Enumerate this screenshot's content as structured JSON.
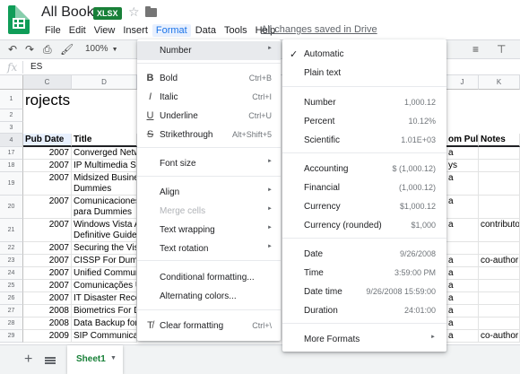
{
  "app": {
    "doc_title": "All Books",
    "file_badge": "XLSX",
    "saved_status": "All changes saved in Drive",
    "colors": {
      "brand_green": "#0f9d58",
      "accent_blue": "#1a73e8"
    }
  },
  "menubar": {
    "items": [
      {
        "label": "File"
      },
      {
        "label": "Edit"
      },
      {
        "label": "View"
      },
      {
        "label": "Insert"
      },
      {
        "label": "Format",
        "active": true
      },
      {
        "label": "Data"
      },
      {
        "label": "Tools"
      },
      {
        "label": "Help"
      }
    ]
  },
  "toolbar": {
    "zoom": "100%",
    "icons": [
      "undo-icon",
      "redo-icon",
      "print-icon",
      "paint-format-icon",
      "align-icon",
      "valign-icon"
    ]
  },
  "formula_bar": {
    "fx": "fx",
    "value": "ES"
  },
  "grid": {
    "columns": [
      {
        "label": "C",
        "selected": true
      },
      {
        "label": "D"
      },
      {
        "label": "J"
      },
      {
        "label": "K"
      }
    ],
    "title_cell": "rojects",
    "header_row": {
      "row": "4",
      "pub_date": "Pub Date",
      "title": "Title",
      "com_pub": "om Pul",
      "notes": "Notes"
    },
    "rows": [
      {
        "row": "1"
      },
      {
        "row": "2"
      },
      {
        "row": "3"
      },
      {
        "row": "17",
        "year": "2007",
        "title": "Converged Netw",
        "j": "a",
        "k": ""
      },
      {
        "row": "18",
        "year": "2007",
        "title": "IP Multimedia Su",
        "j": "ys",
        "k": ""
      },
      {
        "row": "19",
        "year": "2007",
        "title": "Midsized Busine\nDummies",
        "j": "a",
        "k": ""
      },
      {
        "row": "20",
        "year": "2007",
        "title": "Comunicaciones\npara Dummies",
        "j": "a",
        "k": ""
      },
      {
        "row": "21",
        "year": "2007",
        "title": "Windows Vista A\nDefinitive Guide",
        "j": "a",
        "k": "contributo"
      },
      {
        "row": "22",
        "year": "2007",
        "title": "Securing the Vista",
        "j": "",
        "k": ""
      },
      {
        "row": "23",
        "year": "2007",
        "title": "CISSP For Dummi",
        "j": "a",
        "k": "co-author"
      },
      {
        "row": "24",
        "year": "2007",
        "title": "Unified Commun",
        "j": "a",
        "k": ""
      },
      {
        "row": "25",
        "year": "2007",
        "title": "Comunicações Ur",
        "j": "a",
        "k": ""
      },
      {
        "row": "26",
        "year": "2007",
        "title": "IT Disaster Recov",
        "j": "a",
        "k": ""
      },
      {
        "row": "27",
        "year": "2008",
        "title": "Biometrics For Du",
        "j": "a",
        "k": ""
      },
      {
        "row": "28",
        "year": "2008",
        "title": "Data Backup for D",
        "j": "a",
        "k": ""
      },
      {
        "row": "29",
        "year": "2009",
        "title": "SIP Communicati",
        "j": "a",
        "k": "co-author"
      }
    ]
  },
  "sheetbar": {
    "active_tab": "Sheet1"
  },
  "format_menu": {
    "items": [
      {
        "label": "Number",
        "arrow": "►",
        "highlighted": true
      },
      {
        "label": "Bold",
        "shortcut": "Ctrl+B",
        "icon": "B"
      },
      {
        "label": "Italic",
        "shortcut": "Ctrl+I",
        "icon": "I"
      },
      {
        "label": "Underline",
        "shortcut": "Ctrl+U",
        "icon": "U"
      },
      {
        "label": "Strikethrough",
        "shortcut": "Alt+Shift+5",
        "icon": "S"
      },
      {
        "label": "Font size",
        "arrow": "►"
      },
      {
        "label": "Align",
        "arrow": "►"
      },
      {
        "label": "Merge cells",
        "arrow": "►",
        "disabled": true
      },
      {
        "label": "Text wrapping",
        "arrow": "►"
      },
      {
        "label": "Text rotation",
        "arrow": "►"
      },
      {
        "label": "Conditional formatting..."
      },
      {
        "label": "Alternating colors..."
      },
      {
        "label": "Clear formatting",
        "shortcut": "Ctrl+\\"
      }
    ]
  },
  "number_menu": {
    "items": [
      {
        "label": "Automatic",
        "checked": true
      },
      {
        "label": "Plain text"
      },
      {
        "label": "Number",
        "example": "1,000.12"
      },
      {
        "label": "Percent",
        "example": "10.12%"
      },
      {
        "label": "Scientific",
        "example": "1.01E+03"
      },
      {
        "label": "Accounting",
        "example": "$ (1,000.12)"
      },
      {
        "label": "Financial",
        "example": "(1,000.12)"
      },
      {
        "label": "Currency",
        "example": "$1,000.12"
      },
      {
        "label": "Currency (rounded)",
        "example": "$1,000"
      },
      {
        "label": "Date",
        "example": "9/26/2008"
      },
      {
        "label": "Time",
        "example": "3:59:00 PM"
      },
      {
        "label": "Date time",
        "example": "9/26/2008 15:59:00"
      },
      {
        "label": "Duration",
        "example": "24:01:00"
      },
      {
        "label": "More Formats",
        "arrow": "►"
      }
    ]
  }
}
